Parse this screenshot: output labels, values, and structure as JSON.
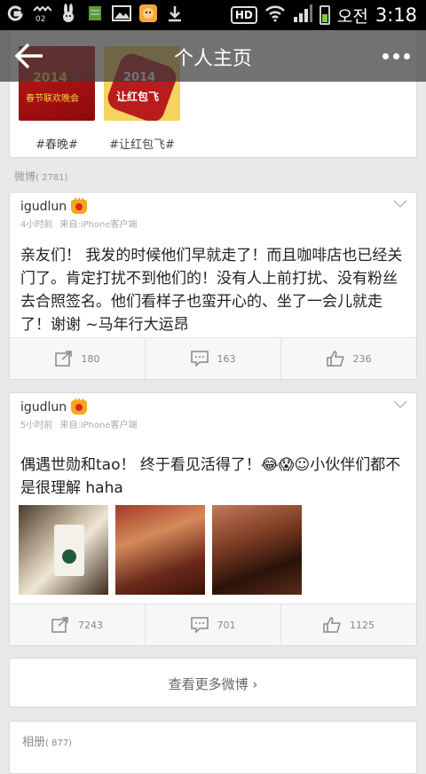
{
  "status_bar": {
    "carrier": "오전",
    "time": "3:18",
    "icons": [
      "g-app-icon",
      "signal-02-icon",
      "rabbit-icon",
      "sim-icon",
      "image-icon",
      "game-icon",
      "download-icon",
      "hd-icon",
      "wifi-icon",
      "cell-signal-icon",
      "battery-icon"
    ],
    "signal_label": "02",
    "hd_label": "HD"
  },
  "titlebar": {
    "title": "个人主页",
    "back_icon": "back-arrow-icon",
    "more_icon": "more-dots-icon"
  },
  "topics": [
    {
      "label": "#春晚#",
      "thumb_title": "2014",
      "thumb_sub": "春节联欢晚会"
    },
    {
      "label": "#让红包飞#",
      "thumb_title": "2014",
      "thumb_sub": "让红包飞"
    }
  ],
  "weibo_section": {
    "label": "微博",
    "count": "( 2781)"
  },
  "posts": [
    {
      "username": "igudlun",
      "time": "4小时前",
      "source": "来自:iPhone客户端",
      "text": "亲友们！ 我发的时候他们早就走了！而且咖啡店也已经关门了。肯定打扰不到他们的！没有人上前打扰、没有粉丝去合照签名。他们看样子也蛮开心的、坐了一会儿就走了！谢谢 ~马年行大运昂",
      "reposts": "180",
      "comments": "163",
      "likes": "236"
    },
    {
      "username": "igudlun",
      "time": "5小时前",
      "source": "来自:iPhone客户端",
      "text": "偶遇世勋和tao！ 终于看见活得了！😂😱☺小伙伴们都不是很理解 haha",
      "reposts": "7243",
      "comments": "701",
      "likes": "1125"
    }
  ],
  "more_weibo": {
    "label": "查看更多微博 ›"
  },
  "album": {
    "label": "相册",
    "count": "( 877)"
  },
  "colors": {
    "accent_crown": "#f2a81d",
    "background": "#e9e9e9"
  }
}
